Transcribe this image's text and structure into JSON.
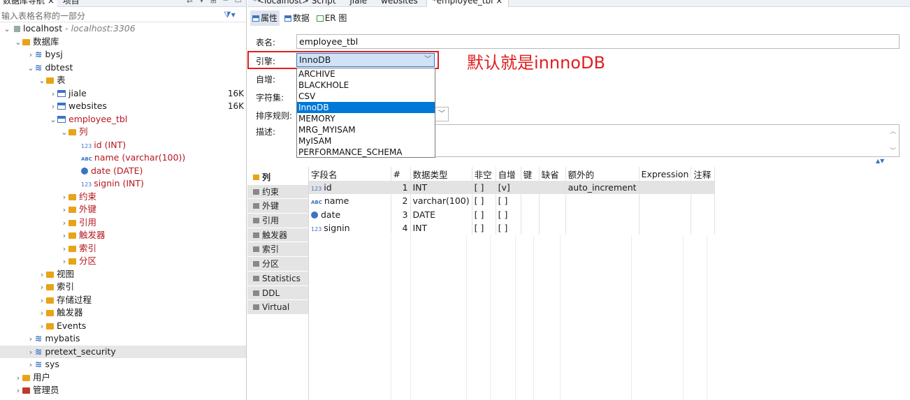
{
  "left_panel": {
    "tabs": [
      {
        "label": "数据库导航 ×"
      },
      {
        "label": "项目"
      }
    ],
    "filter_placeholder": "输入表格名称的一部分",
    "tree": {
      "host": {
        "label": "localhost",
        "sub": " - localhost:3306"
      },
      "databases_folder": "数据库",
      "bysj": "bysj",
      "dbtest": "dbtest",
      "tables_folder": "表",
      "jiale": {
        "label": "jiale",
        "size": "16K"
      },
      "websites": {
        "label": "websites",
        "size": "16K"
      },
      "employee_tbl": "employee_tbl",
      "columns_folder": "列",
      "columns": [
        "id (INT)",
        "name (varchar(100))",
        "date (DATE)",
        "signin (INT)"
      ],
      "table_children": [
        "约束",
        "外键",
        "引用",
        "触发器",
        "索引",
        "分区"
      ],
      "db_children": [
        "视图",
        "索引",
        "存储过程",
        "触发器",
        "Events"
      ],
      "other_dbs": [
        "mybatis",
        "pretext_security",
        "sys"
      ],
      "host_children": [
        "用户",
        "管理员"
      ]
    }
  },
  "editor": {
    "tabs": [
      "*<localhost> Script",
      "jiale",
      "websites",
      "*employee_tbl ×"
    ],
    "sub_tabs": [
      "属性",
      "数据",
      "ER 图"
    ],
    "table_name_label": "表名:",
    "table_name_value": "employee_tbl",
    "engine_label": "引擎:",
    "engine_value": "InnoDB",
    "engine_options": [
      "ARCHIVE",
      "BLACKHOLE",
      "CSV",
      "InnoDB",
      "MEMORY",
      "MRG_MYISAM",
      "MyISAM",
      "PERFORMANCE_SCHEMA"
    ],
    "selected_engine_index": 3,
    "annotation": "默认就是innnoDB",
    "auto_inc_label": "自增:",
    "charset_label": "字符集:",
    "collation_label": "排序规则:",
    "description_label": "描述:",
    "sections": [
      "列",
      "约束",
      "外键",
      "引用",
      "触发器",
      "索引",
      "分区",
      "Statistics",
      "DDL",
      "Virtual"
    ],
    "columns_table": {
      "headers": [
        "字段名",
        "#",
        "数据类型",
        "非空",
        "自增",
        "键",
        "缺省",
        "额外的",
        "Expression",
        "注释"
      ],
      "rows": [
        {
          "name": "id",
          "type_icon": "123",
          "num": "1",
          "dtype": "INT",
          "notnull": "[ ]",
          "autoinc": "[v]",
          "key": "",
          "default": "",
          "extra": "auto_increment",
          "expr": "",
          "comment": ""
        },
        {
          "name": "name",
          "type_icon": "abc",
          "num": "2",
          "dtype": "varchar(100)",
          "notnull": "[ ]",
          "autoinc": "[ ]",
          "key": "",
          "default": "",
          "extra": "",
          "expr": "",
          "comment": ""
        },
        {
          "name": "date",
          "type_icon": "clock",
          "num": "3",
          "dtype": "DATE",
          "notnull": "[ ]",
          "autoinc": "[ ]",
          "key": "",
          "default": "",
          "extra": "",
          "expr": "",
          "comment": ""
        },
        {
          "name": "signin",
          "type_icon": "123",
          "num": "4",
          "dtype": "INT",
          "notnull": "[ ]",
          "autoinc": "[ ]",
          "key": "",
          "default": "",
          "extra": "",
          "expr": "",
          "comment": ""
        }
      ]
    }
  },
  "colors": {
    "accent": "#3a73c4",
    "annotation": "#e01e1e",
    "selection": "#0078d7",
    "folder": "#e8a317"
  }
}
